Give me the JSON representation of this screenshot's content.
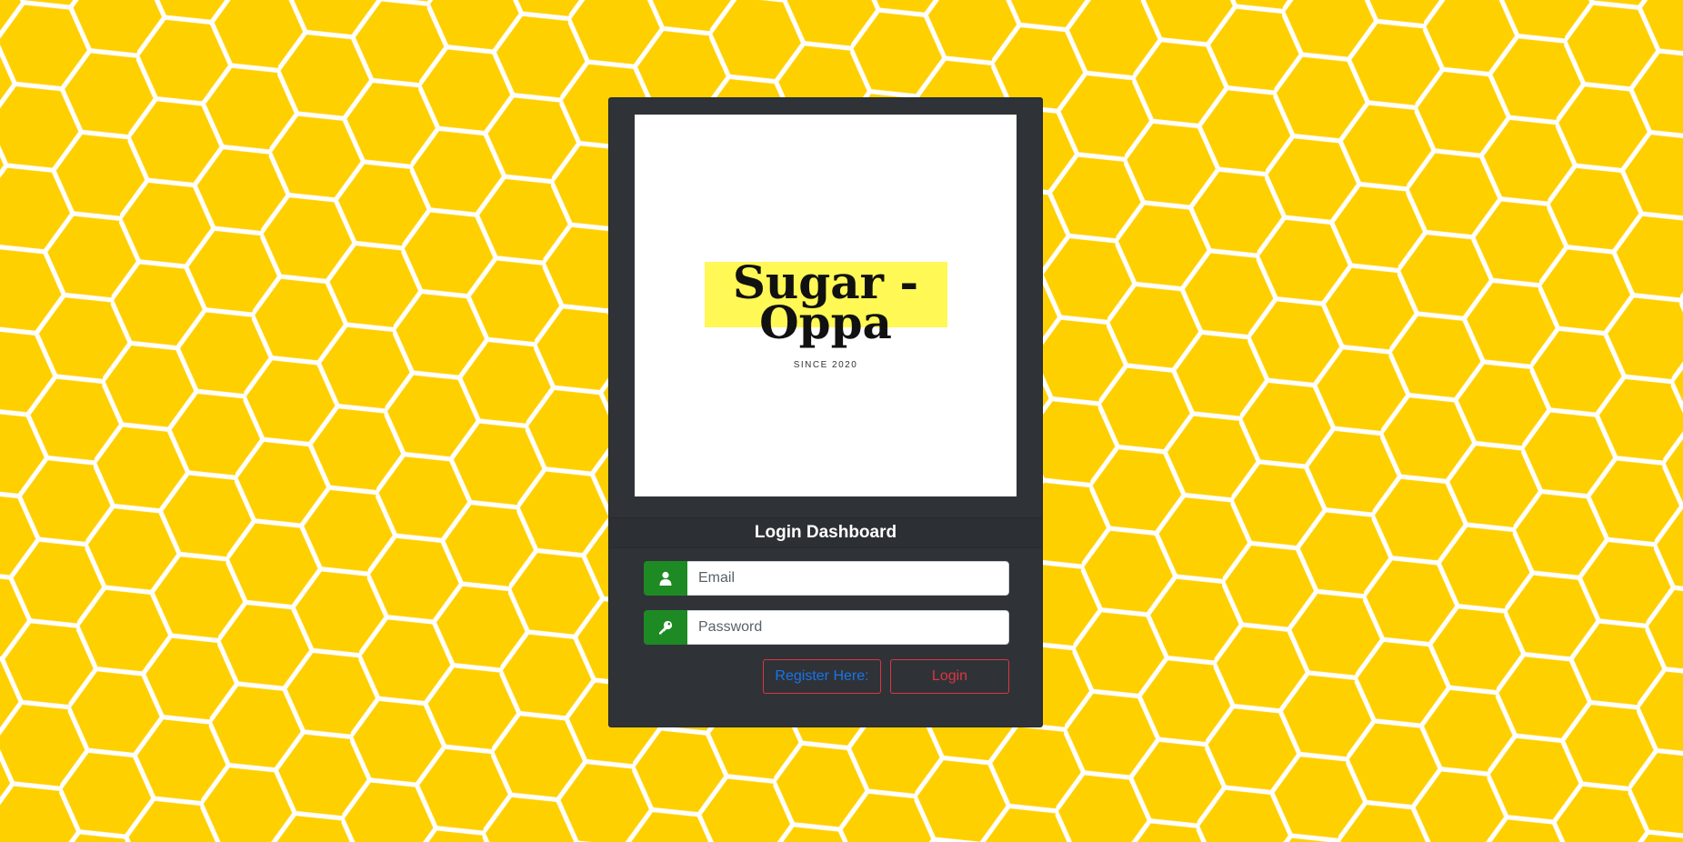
{
  "colors": {
    "background": "#ffd000",
    "honeycomb_lines": "#ffffff",
    "card": "#2f3337",
    "addon_green": "#1e8a24",
    "logo_highlight": "#fff855",
    "register_text": "#1a73e8",
    "login_accent": "#dc3545"
  },
  "logo": {
    "line1": "Sugar -",
    "line2": "Oppa",
    "since": "SINCE 2020"
  },
  "card": {
    "title": "Login Dashboard"
  },
  "form": {
    "email": {
      "icon": "user-icon",
      "placeholder": "Email",
      "value": ""
    },
    "password": {
      "icon": "key-icon",
      "placeholder": "Password",
      "value": ""
    }
  },
  "buttons": {
    "register_label": "Register Here:",
    "login_label": "Login"
  }
}
